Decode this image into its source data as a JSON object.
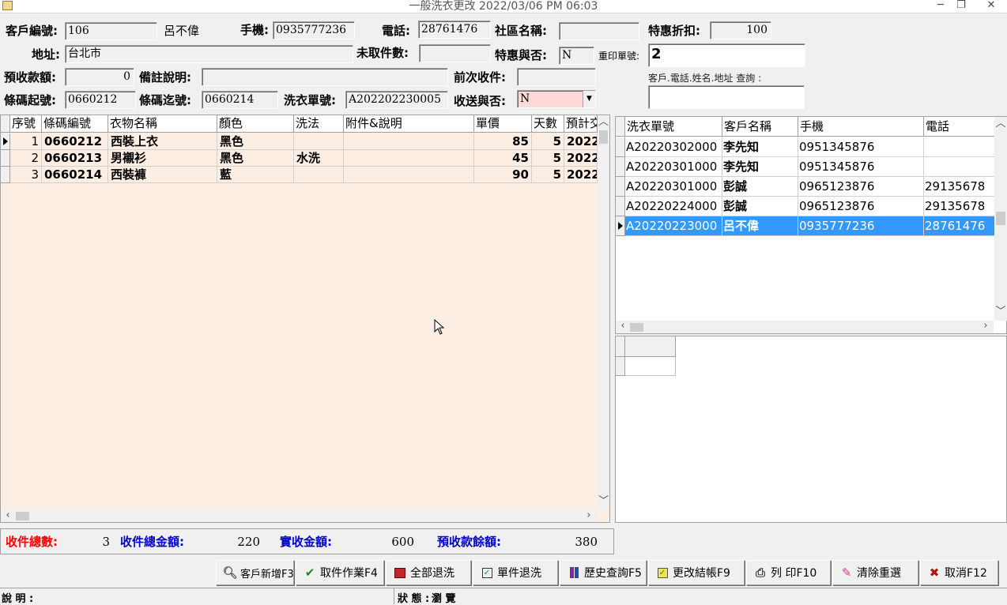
{
  "window": {
    "title": "一般洗衣更改 2022/03/06 PM 06:03",
    "btn_min": "─",
    "btn_max": "❐",
    "btn_close": "✕"
  },
  "form": {
    "cust_no_label": "客戶編號:",
    "cust_no": "106",
    "cust_name": "呂不偉",
    "mobile_label": "手機:",
    "mobile": "0935777236",
    "phone_label": "電話:",
    "phone": "28761476",
    "community_label": "社區名稱:",
    "community": "",
    "discount_label": "特惠折扣:",
    "discount": "100",
    "address_label": "地址:",
    "address": "台北市",
    "unpicked_label": "未取件數:",
    "unpicked": "",
    "special_label": "特惠與否:",
    "special": "N",
    "reprint_label": "重印單號:",
    "reprint": "2",
    "prepaid_label": "預收款額:",
    "prepaid": "0",
    "note_label": "備註說明:",
    "note": "",
    "prev_label": "前次收件:",
    "prev": "",
    "search_label": "客戶.電話.姓名.地址 查詢 :",
    "search": "",
    "barcode_from_label": "條碼起號:",
    "barcode_from": "0660212",
    "barcode_to_label": "條碼迄號:",
    "barcode_to": "0660214",
    "order_label": "洗衣單號:",
    "order": "A202202230005",
    "delivery_label": "收送與否:",
    "delivery": "N"
  },
  "items": {
    "headers": [
      "序號",
      "條碼編號",
      "衣物名稱",
      "顏色",
      "洗法",
      "附件&說明",
      "單價",
      "天數",
      "預計交"
    ],
    "rows": [
      [
        "1",
        "0660212",
        "西裝上衣",
        "黑色",
        "",
        "",
        "85",
        "5",
        "2022."
      ],
      [
        "2",
        "0660213",
        "男襯衫",
        "黑色",
        "水洗",
        "",
        "45",
        "5",
        "2022."
      ],
      [
        "3",
        "0660214",
        "西裝褲",
        "藍",
        "",
        "",
        "90",
        "5",
        "2022."
      ]
    ]
  },
  "orders": {
    "headers": [
      "洗衣單號",
      "客戶名稱",
      "手機",
      "電話"
    ],
    "rows": [
      [
        "A20220302000",
        "李先知",
        "0951345876",
        ""
      ],
      [
        "A20220301000",
        "李先知",
        "0951345876",
        ""
      ],
      [
        "A20220301000",
        "彭誠",
        "0965123876",
        "29135678"
      ],
      [
        "A20220224000",
        "彭誠",
        "0965123876",
        "29135678"
      ],
      [
        "A20220223000",
        "呂不偉",
        "0935777236",
        "28761476"
      ]
    ]
  },
  "summary": {
    "count_label": "收件總數:",
    "count": "3",
    "total_label": "收件總金額:",
    "total": "220",
    "paid_label": "實收金額:",
    "paid": "600",
    "balance_label": "預收款餘額:",
    "balance": "380"
  },
  "toolbar": {
    "add_customer": "客戶新增F3",
    "pickup": "取件作業F4",
    "return_all": "全部退洗",
    "return_single": "單件退洗",
    "history": "歷史查詢F5",
    "change_settle": "更改結帳F9",
    "print": "列 印F10",
    "clear": "清除重選",
    "cancel": "取消F12"
  },
  "status": {
    "desc_label": "說 明 :",
    "state_label": "狀 態 :",
    "state": "瀏 覽"
  },
  "colors": {
    "accent_red": "#ff0000",
    "accent_blue": "#0000cc",
    "selected": "#3399ff",
    "row_bg": "#fdeee4"
  }
}
